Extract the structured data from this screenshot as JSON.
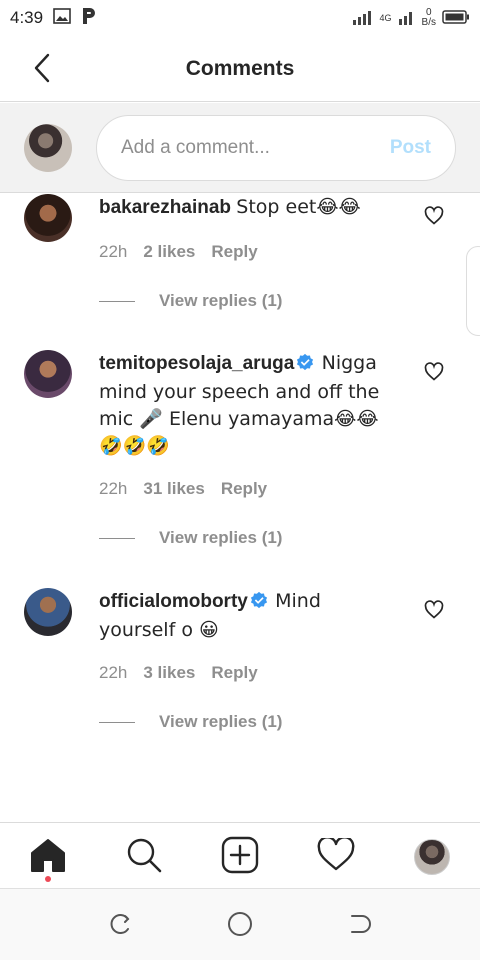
{
  "status_bar": {
    "time": "4:39",
    "network_type": "4G",
    "speed_value": "0",
    "speed_unit": "B/s"
  },
  "header": {
    "title": "Comments",
    "back_icon": "chevron-left-icon"
  },
  "composer": {
    "placeholder": "Add a comment...",
    "post_label": "Post"
  },
  "comments": [
    {
      "username": "bakarezhainab",
      "verified": false,
      "text": "Stop eet😂😂",
      "time": "22h",
      "likes": "2 likes",
      "reply": "Reply",
      "view_replies": "View replies (1)"
    },
    {
      "username": "temitopesolaja_aruga",
      "verified": true,
      "text": "Nigga mind your speech and off the mic 🎤 Elenu yamayama😂😂🤣🤣🤣",
      "time": "22h",
      "likes": "31 likes",
      "reply": "Reply",
      "view_replies": "View replies (1)"
    },
    {
      "username": "officialomoborty",
      "verified": true,
      "text": "Mind yourself o 😀",
      "time": "22h",
      "likes": "3 likes",
      "reply": "Reply",
      "view_replies": "View replies (1)"
    }
  ],
  "tabbar": {
    "items": [
      "home-icon",
      "search-icon",
      "add-post-icon",
      "heart-icon",
      "profile-avatar"
    ],
    "active": "home-icon",
    "notification_color": "#ed4956"
  },
  "colors": {
    "post_disabled": "#b2dffc",
    "verified_blue": "#3897f0",
    "secondary_text": "#8e8e8e"
  }
}
